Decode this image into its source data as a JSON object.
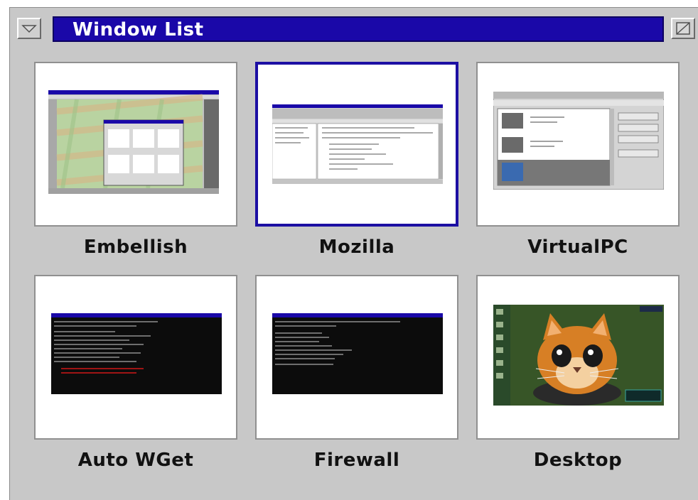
{
  "window": {
    "title": "Window List"
  },
  "items": [
    {
      "label": "Embellish",
      "selected": false
    },
    {
      "label": "Mozilla",
      "selected": true
    },
    {
      "label": "VirtualPC",
      "selected": false
    },
    {
      "label": "Auto WGet",
      "selected": false
    },
    {
      "label": "Firewall",
      "selected": false
    },
    {
      "label": "Desktop",
      "selected": false
    }
  ],
  "colors": {
    "title_bar": "#1a08a8",
    "panel": "#c8c8c8",
    "selection": "#1c0fa3"
  }
}
